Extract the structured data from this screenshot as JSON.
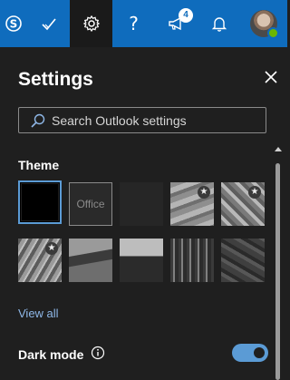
{
  "topbar": {
    "background": "#0f6cbd",
    "buttons": [
      {
        "icon": "skype-icon"
      },
      {
        "icon": "checkmark-icon"
      },
      {
        "icon": "gear-icon",
        "active": true
      },
      {
        "icon": "help-icon",
        "glyph": "?"
      },
      {
        "icon": "megaphone-icon",
        "badge": "4"
      },
      {
        "icon": "bell-icon"
      }
    ],
    "avatar": {
      "icon": "avatar",
      "presence": "available"
    }
  },
  "panel": {
    "title": "Settings",
    "search": {
      "placeholder": "Search Outlook settings"
    },
    "theme": {
      "label": "Theme",
      "tiles": [
        {
          "name": "black",
          "selected": true
        },
        {
          "name": "office",
          "text": "Office"
        },
        {
          "name": "dark"
        },
        {
          "name": "pattern-1",
          "starred": true
        },
        {
          "name": "pattern-2",
          "starred": true
        },
        {
          "name": "pattern-3",
          "starred": true
        },
        {
          "name": "pattern-4"
        },
        {
          "name": "pattern-5"
        },
        {
          "name": "pattern-6"
        },
        {
          "name": "pattern-7"
        }
      ],
      "star_glyph": "★",
      "view_all": "View all"
    },
    "dark_mode": {
      "label": "Dark mode",
      "enabled": true
    },
    "accent": "#5b9bd5"
  }
}
